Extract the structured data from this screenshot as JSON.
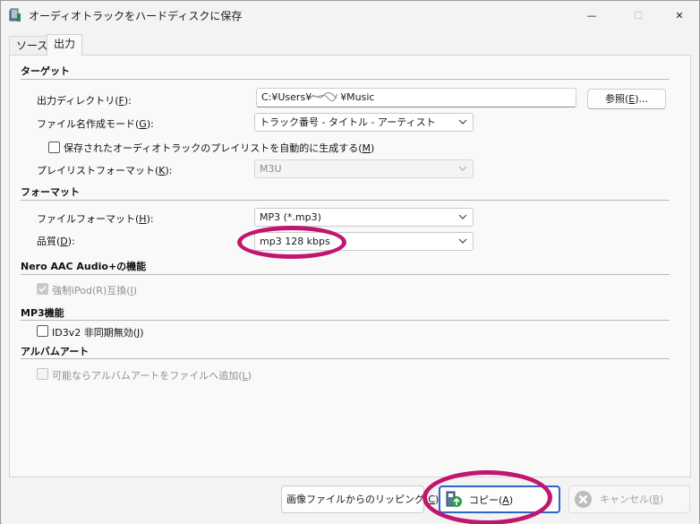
{
  "window": {
    "title": "オーディオトラックをハードディスクに保存",
    "minimize_glyph": "—",
    "maximize_glyph": "☐",
    "close_glyph": "✕"
  },
  "tabs": [
    {
      "label": "ソース",
      "active": false
    },
    {
      "label": "出力",
      "active": true
    }
  ],
  "target": {
    "heading": "ターゲット",
    "output_dir_label": "出力ディレクトリ(",
    "output_dir_key": "F",
    "output_dir_label_end": "):",
    "output_dir_value_prefix": "C:¥Users¥",
    "output_dir_value_suffix": "¥Music",
    "browse_label": "参照(",
    "browse_key": "E",
    "browse_label_end": ")...",
    "naming_label": "ファイル名作成モード(",
    "naming_key": "G",
    "naming_label_end": "):",
    "naming_value": "トラック番号 - タイトル - アーティスト",
    "playlist_checkbox_label": "保存されたオーディオトラックのプレイリストを自動的に生成する(",
    "playlist_checkbox_key": "M",
    "playlist_checkbox_label_end": ")",
    "playlist_checked": false,
    "playlist_format_label": "プレイリストフォーマット(",
    "playlist_format_key": "K",
    "playlist_format_label_end": "):",
    "playlist_format_value": "M3U"
  },
  "format": {
    "heading": "フォーマット",
    "file_format_label": "ファイルフォーマット(",
    "file_format_key": "H",
    "file_format_label_end": "):",
    "file_format_value": "MP3 (*.mp3)",
    "quality_label": "品質(",
    "quality_key": "D",
    "quality_label_end": "):",
    "quality_value": "mp3 128 kbps"
  },
  "nero_aac": {
    "heading": "Nero AAC Audio+の機能",
    "ipod_label": "強制iPod(R)互換(",
    "ipod_key": "I",
    "ipod_label_end": ")",
    "ipod_checked": true
  },
  "mp3": {
    "heading": "MP3機能",
    "id3_label": "ID3v2 非同期無効(",
    "id3_key": "J",
    "id3_label_end": ")",
    "id3_checked": false
  },
  "album_art": {
    "heading": "アルバムアート",
    "add_art_label": "可能ならアルバムアートをファイルへ追加(",
    "add_art_key": "L",
    "add_art_label_end": ")",
    "add_art_checked": false
  },
  "footer": {
    "rip_label": "画像ファイルからのリッピング(",
    "rip_key": "C",
    "rip_label_end": ")",
    "copy_label": "コピー(",
    "copy_key": "A",
    "copy_label_end": ")",
    "cancel_label": "キャンセル(",
    "cancel_key": "B",
    "cancel_label_end": ")"
  },
  "colors": {
    "annotation": "#c2156f",
    "primary_border": "#2f66c5"
  },
  "icons": {
    "app": "app-disc-icon",
    "dropdown": "chevron-down-icon",
    "copy": "copy-disc-icon",
    "cancel": "cancel-x-icon"
  }
}
